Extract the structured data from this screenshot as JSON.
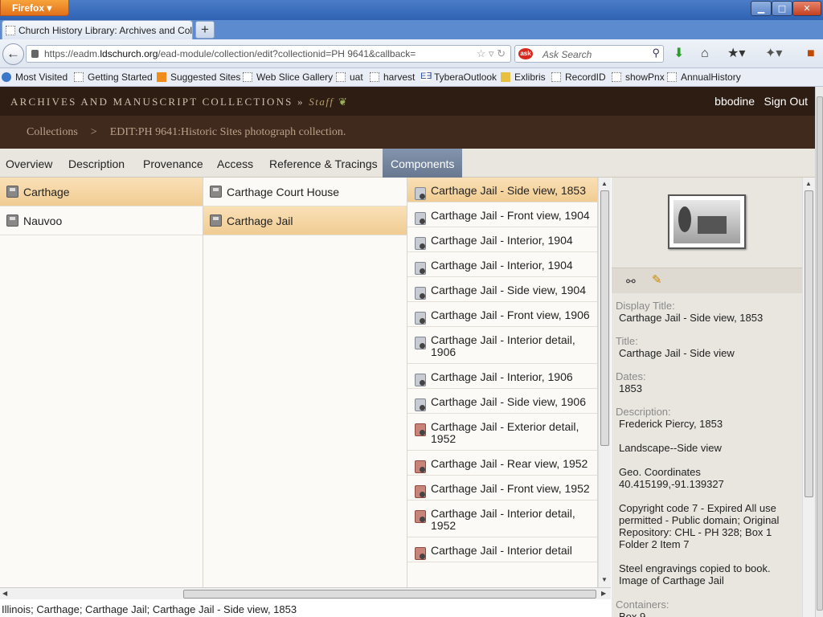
{
  "browser": {
    "menu_button": "Firefox",
    "tab_title": "Church History Library: Archives and Coll...",
    "url_prefix": "https://eadm.",
    "url_domain": "ldschurch.org",
    "url_rest": "/ead-module/collection/edit?collectionid=PH 9641&callback=",
    "search_placeholder": "Ask Search",
    "bookmarks": [
      "Most Visited",
      "Getting Started",
      "Suggested Sites",
      "Web Slice Gallery",
      "uat",
      "harvest",
      "TyberaOutlook",
      "Exlibris",
      "RecordID",
      "showPnx",
      "AnnualHistory"
    ]
  },
  "header": {
    "brand": "ARCHIVES AND MANUSCRIPT COLLECTIONS",
    "brand_sep": " » ",
    "staff": "Staff",
    "user": "bbodine",
    "sign_out": "Sign Out"
  },
  "breadcrumb": {
    "root": "Collections",
    "sep": ">",
    "current": "EDIT:PH 9641:Historic Sites photograph collection."
  },
  "tabs": [
    "Overview",
    "Description",
    "Provenance",
    "Access",
    "Reference & Tracings",
    "Components"
  ],
  "columns": {
    "col1": [
      "Carthage",
      "Nauvoo"
    ],
    "col2": [
      "Carthage Court House",
      "Carthage Jail"
    ],
    "col3": [
      "Carthage Jail - Side view, 1853",
      "Carthage Jail - Front view, 1904",
      "Carthage Jail - Interior, 1904",
      "Carthage Jail - Interior, 1904",
      "Carthage Jail - Side view, 1904",
      "Carthage Jail - Front view, 1906",
      "Carthage Jail - Interior detail, 1906",
      "Carthage Jail - Interior, 1906",
      "Carthage Jail - Side view, 1906",
      "Carthage Jail - Exterior detail, 1952",
      "Carthage Jail - Rear view, 1952",
      "Carthage Jail - Front view, 1952",
      "Carthage Jail - Interior detail, 1952",
      "Carthage Jail - Interior detail"
    ]
  },
  "status_path": "Illinois; Carthage; Carthage Jail; Carthage Jail - Side view, 1853",
  "detail": {
    "display_title_label": "Display Title:",
    "display_title": "Carthage Jail - Side view, 1853",
    "title_label": "Title:",
    "title": "Carthage Jail - Side view",
    "dates_label": "Dates:",
    "dates": "1853",
    "description_label": "Description:",
    "description": [
      "Frederick Piercy, 1853",
      "Landscape--Side view",
      "Geo. Coordinates 40.415199,-91.139327",
      "Copyright code 7 - Expired All use permitted - Public domain; Original Repository: CHL - PH 328; Box 1 Folder 2 Item 7",
      "Steel engravings copied to book. Image of Carthage Jail"
    ],
    "containers_label": "Containers:",
    "containers": "Box 9"
  }
}
